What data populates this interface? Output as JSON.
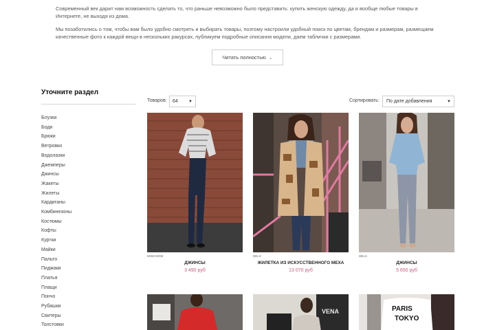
{
  "intro": {
    "paragraph1": "Современный век дарит нам возможность сделать то, что раньше невозможно было представить: купить женскую одежду, да и вообще любые товары в Интернете, не выходя из дома.",
    "paragraph2": "Мы позаботились о том, чтобы вам было удобно смотреть и выбирать товары, поэтому настроили удобный поиск по цветам, брендам и размерам, размещаем качественные фото к каждой вещи в нескольких ракурсах, публикуем подробные описания модели, даем таблички с размерами."
  },
  "read_more": {
    "label": "Читать полностью",
    "icon": "chevron-down-icon"
  },
  "sidebar": {
    "title": "Уточните раздел",
    "items": [
      "Блузки",
      "Боди",
      "Брюки",
      "Ветровки",
      "Водолазки",
      "Джемперы",
      "Джинсы",
      "Жакеты",
      "Жилеты",
      "Кардиганы",
      "Комбинезоны",
      "Костюмы",
      "Кофты",
      "Куртки",
      "Майки",
      "Пальто",
      "Пиджаки",
      "Платья",
      "Плащи",
      "Пончо",
      "Рубашки",
      "Свитеры",
      "Толстовки"
    ]
  },
  "toolbar": {
    "count_label": "Товаров:",
    "count_value": "64",
    "sort_label": "Сортировать:",
    "sort_value": "По дате добавления"
  },
  "products": [
    {
      "brand": "MOM MOM",
      "name": "ДЖИНСЫ",
      "price": "3 490 руб"
    },
    {
      "brand": "DELS",
      "name": "ЖИЛЕТКА ИЗ ИСКУССТВЕННОГО МЕХА",
      "price": "13 070 руб"
    },
    {
      "brand": "DELS",
      "name": "ДЖИНСЫ",
      "price": "5 650 руб"
    }
  ],
  "row2_tags": [
    "VENA",
    "PARIS",
    "TOKYO"
  ],
  "colors": {
    "price": "#d65b7a",
    "accent": "#222222"
  }
}
